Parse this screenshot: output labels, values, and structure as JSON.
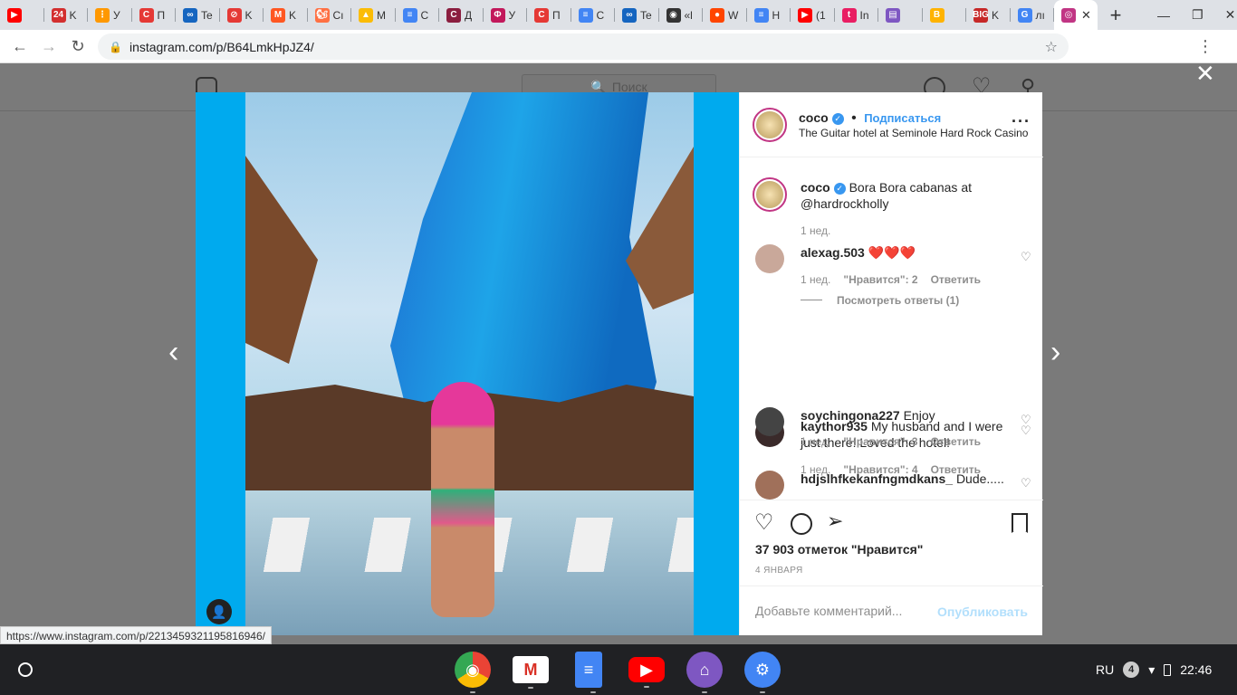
{
  "browser": {
    "tabs": [
      {
        "icon": "youtube-icon",
        "color": "#ff0000",
        "glyph": "▶",
        "label": ""
      },
      {
        "icon": "news24-icon",
        "color": "#d32f2f",
        "glyph": "24",
        "label": "K"
      },
      {
        "icon": "grid-icon",
        "color": "#ff9800",
        "glyph": "⋮",
        "label": "У"
      },
      {
        "icon": "circle-c-icon",
        "color": "#e53935",
        "glyph": "C",
        "label": "П"
      },
      {
        "icon": "infinity-icon",
        "color": "#1565c0",
        "glyph": "∞",
        "label": "Te"
      },
      {
        "icon": "prohibited-icon",
        "color": "#e53935",
        "glyph": "⊘",
        "label": "K"
      },
      {
        "icon": "m-logo-icon",
        "color": "#ff5722",
        "glyph": "M",
        "label": "K"
      },
      {
        "icon": "squirrel-icon",
        "color": "#ff7043",
        "glyph": "🐿",
        "label": "Сı"
      },
      {
        "icon": "drive-icon",
        "color": "#fbbc05",
        "glyph": "▲",
        "label": "M"
      },
      {
        "icon": "docs-icon",
        "color": "#4285f4",
        "glyph": "≡",
        "label": "C"
      },
      {
        "icon": "c-square-icon",
        "color": "#8b1e3f",
        "glyph": "C",
        "label": "Д"
      },
      {
        "icon": "phi-icon",
        "color": "#c2185b",
        "glyph": "Φ",
        "label": "У"
      },
      {
        "icon": "circle-c-icon",
        "color": "#e53935",
        "glyph": "C",
        "label": "П"
      },
      {
        "icon": "docs-icon",
        "color": "#4285f4",
        "glyph": "≡",
        "label": "C"
      },
      {
        "icon": "infinity-icon",
        "color": "#1565c0",
        "glyph": "∞",
        "label": "Te"
      },
      {
        "icon": "panda-icon",
        "color": "#333333",
        "glyph": "◉",
        "label": "«l"
      },
      {
        "icon": "reddit-icon",
        "color": "#ff4500",
        "glyph": "●",
        "label": "W"
      },
      {
        "icon": "docs-icon",
        "color": "#4285f4",
        "glyph": "≡",
        "label": "H"
      },
      {
        "icon": "youtube-icon",
        "color": "#ff0000",
        "glyph": "▶",
        "label": "(1"
      },
      {
        "icon": "t-icon",
        "color": "#e91e63",
        "glyph": "t",
        "label": "In"
      },
      {
        "icon": "chat-icon",
        "color": "#7e57c2",
        "glyph": "▤",
        "label": ""
      },
      {
        "icon": "b-icon",
        "color": "#ffb300",
        "glyph": "B",
        "label": ""
      },
      {
        "icon": "big-icon",
        "color": "#c62828",
        "glyph": "BIG",
        "label": "K"
      },
      {
        "icon": "google-icon",
        "color": "#4285f4",
        "glyph": "G",
        "label": "лı"
      }
    ],
    "active_tab": {
      "icon": "instagram-icon",
      "color": "#c13584",
      "glyph": "◎"
    },
    "url": "instagram.com/p/B64LmkHpJZ4/"
  },
  "instagram": {
    "search_placeholder": "Поиск",
    "post": {
      "username": "coco",
      "follow_label": "Подписаться",
      "location": "The Guitar hotel at Seminole Hard Rock Casino",
      "caption_text": "Bora Bora cabanas at @hardrockholly",
      "caption_time": "1 нед.",
      "likes": "37 903 отметок \"Нравится\"",
      "date": "4 ЯНВАРЯ",
      "add_comment_placeholder": "Добавьте комментарий...",
      "publish_label": "Опубликовать"
    },
    "comments": [
      {
        "user": "alexag.503",
        "text": "❤️❤️❤️",
        "time": "1 нед.",
        "likes": "\"Нравится\": 2",
        "reply": "Ответить",
        "view_replies": "Посмотреть ответы (1)"
      },
      {
        "user": "kaythor935",
        "text": "My husband and I were just there! Loved the hotel!",
        "time": "1 нед.",
        "likes": "\"Нравится\": 4",
        "reply": "Ответить"
      },
      {
        "user": "soychingona227",
        "text": "Enjoy",
        "time": "1 нед.",
        "likes": "\"Нравится\": 3",
        "reply": "Ответить"
      },
      {
        "user": "hdjslhfkekanfngmdkans_",
        "text": "Dude.....",
        "time": "",
        "likes": "",
        "reply": ""
      }
    ]
  },
  "status_url": "https://www.instagram.com/p/2213459321195816946/",
  "shelf": {
    "apps": [
      {
        "icon": "chrome-icon",
        "color": "#ffffff"
      },
      {
        "icon": "gmail-icon",
        "color": "#ffffff"
      },
      {
        "icon": "docs-icon",
        "color": "#4285f4"
      },
      {
        "icon": "youtube-icon",
        "color": "#ff0000"
      },
      {
        "icon": "assistant-icon",
        "color": "#7e57c2"
      },
      {
        "icon": "settings-icon",
        "color": "#4285f4"
      }
    ],
    "lang": "RU",
    "notifications": "4",
    "time": "22:46"
  }
}
